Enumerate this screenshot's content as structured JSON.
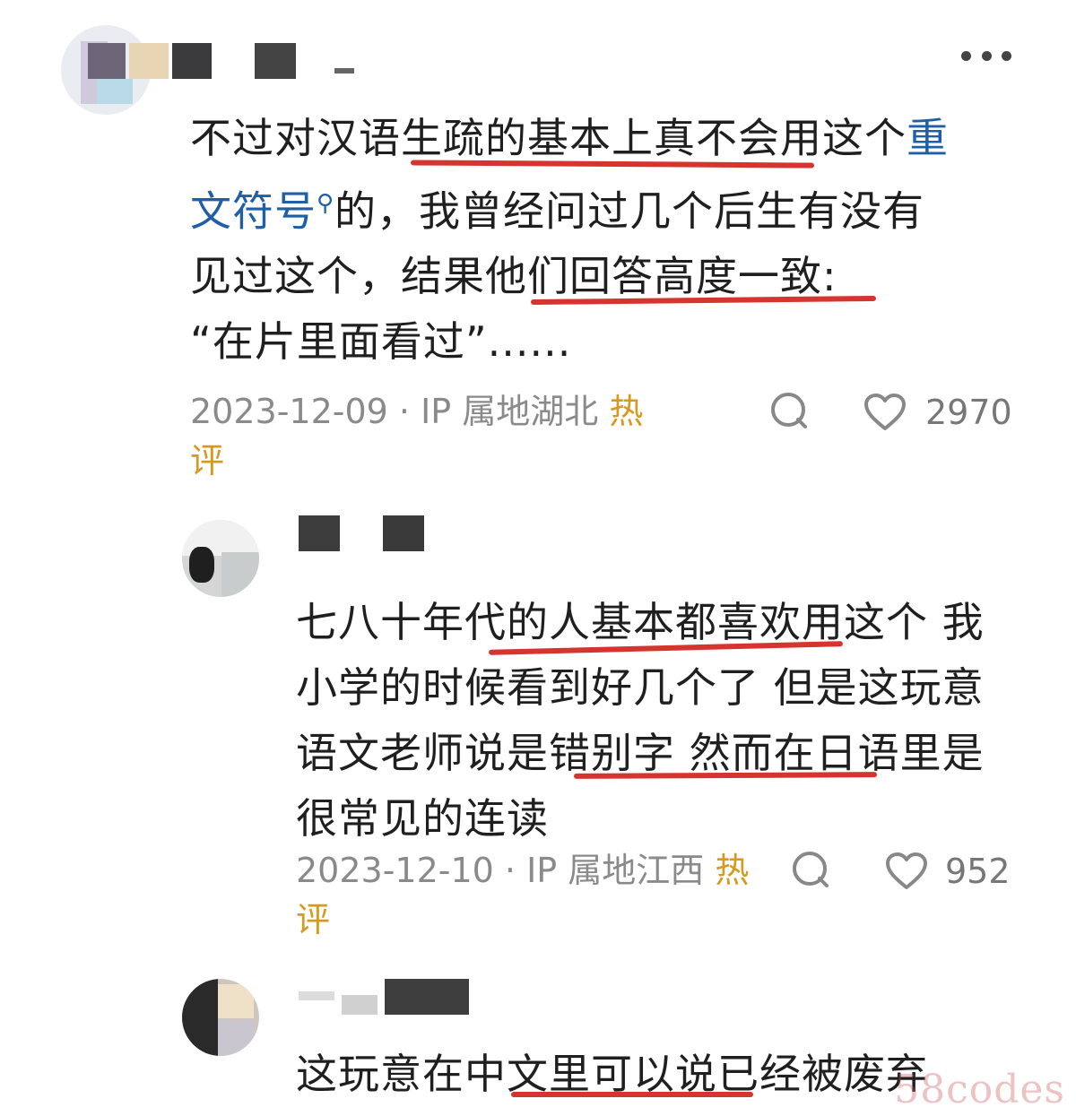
{
  "more_icon": "more-dots-icon",
  "comments": [
    {
      "lines": [
        "不过对汉语生疏的基本上真不会用这个",
        "文符号",
        "的，我曾经问过几个后生有没有",
        "见过这个，结果他们回答高度一致:",
        "“在片里面看过”......"
      ],
      "link_first": "重",
      "link_rest": "文符号",
      "magnifier": "search-icon",
      "date": "2023-12-09 · IP 属地湖北",
      "badge": "热评",
      "likes": "2970"
    },
    {
      "lines": [
        "七八十年代的人基本都喜欢用这个 我",
        "小学的时候看到好几个了 但是这玩意",
        "语文老师说是错别字 然而在日语里是",
        "很常见的连读"
      ],
      "date": "2023-12-10 · IP 属地江西",
      "badge": "热评",
      "likes": "952"
    },
    {
      "lines": [
        "这玩意在中文里可以说已经被废弃"
      ]
    }
  ],
  "watermark": "58codes",
  "colors": {
    "underline": "#d6342f",
    "link": "#1f5fa8",
    "hot": "#d69a1f"
  }
}
